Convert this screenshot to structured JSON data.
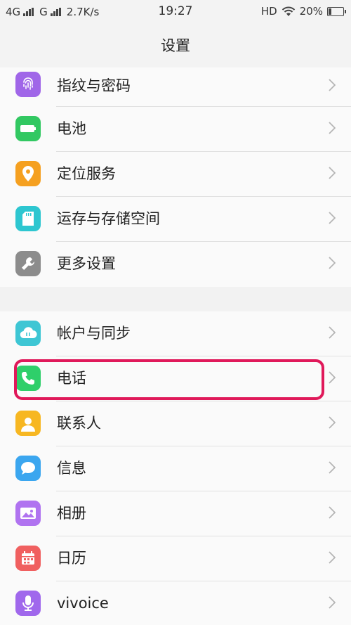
{
  "status_bar": {
    "net1": "4G",
    "net2": "G",
    "speed": "2.7K/s",
    "time": "19:27",
    "hd": "HD",
    "battery": "20%",
    "battery_level": 0.2
  },
  "title": "设置",
  "group1": {
    "items": [
      {
        "label": "指纹与密码",
        "icon": "fingerprint-icon",
        "color": "#a066e8"
      },
      {
        "label": "电池",
        "icon": "battery-icon",
        "color": "#32c862"
      },
      {
        "label": "定位服务",
        "icon": "location-pin-icon",
        "color": "#f5a020"
      },
      {
        "label": "运存与存储空间",
        "icon": "sd-card-icon",
        "color": "#2dc6d0"
      },
      {
        "label": "更多设置",
        "icon": "wrench-icon",
        "color": "#8c8c8c"
      }
    ]
  },
  "group2": {
    "items": [
      {
        "label": "帐户与同步",
        "icon": "cloud-sync-icon",
        "color": "#3ec6d4"
      },
      {
        "label": "电话",
        "icon": "phone-icon",
        "color": "#2fcf6a"
      },
      {
        "label": "联系人",
        "icon": "contact-icon",
        "color": "#f7b722"
      },
      {
        "label": "信息",
        "icon": "message-icon",
        "color": "#3ba6ef"
      },
      {
        "label": "相册",
        "icon": "photo-icon",
        "color": "#b073f0"
      },
      {
        "label": "日历",
        "icon": "calendar-icon",
        "color": "#f06060"
      },
      {
        "label": "vivoice",
        "icon": "microphone-icon",
        "color": "#a068ec"
      }
    ]
  },
  "highlight_color": "#e0195a"
}
